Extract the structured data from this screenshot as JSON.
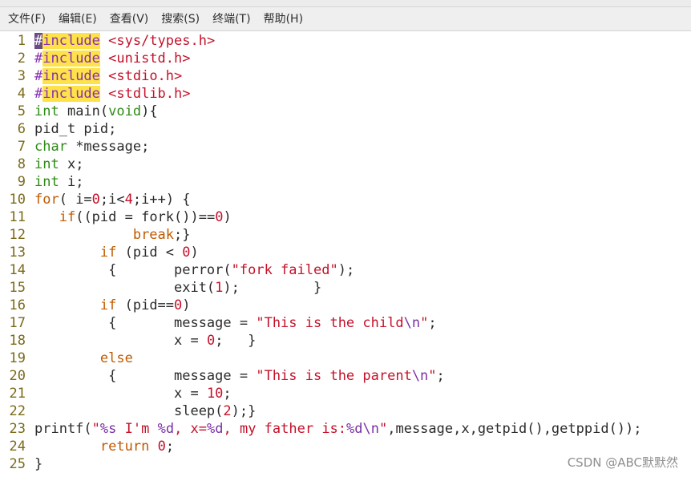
{
  "menubar": {
    "items": [
      "文件(F)",
      "编辑(E)",
      "查看(V)",
      "搜索(S)",
      "终端(T)",
      "帮助(H)"
    ]
  },
  "editor": {
    "lines": [
      {
        "no": "1",
        "tokens": [
          {
            "t": "#",
            "c": "hash"
          },
          {
            "t": "include",
            "c": "kw-incl hl"
          },
          {
            "t": " <sys/types.h>",
            "c": "str"
          }
        ]
      },
      {
        "no": "2",
        "tokens": [
          {
            "t": "#",
            "c": "kw-incl"
          },
          {
            "t": "include",
            "c": "kw-incl hl"
          },
          {
            "t": " <unistd.h>",
            "c": "str"
          }
        ]
      },
      {
        "no": "3",
        "tokens": [
          {
            "t": "#",
            "c": "kw-incl"
          },
          {
            "t": "include",
            "c": "kw-incl hl"
          },
          {
            "t": " <stdio.h>",
            "c": "str"
          }
        ]
      },
      {
        "no": "4",
        "tokens": [
          {
            "t": "#",
            "c": "kw-incl"
          },
          {
            "t": "include",
            "c": "kw-incl hl"
          },
          {
            "t": " <stdlib.h>",
            "c": "str"
          }
        ]
      },
      {
        "no": "5",
        "tokens": [
          {
            "t": "int",
            "c": "ty"
          },
          {
            "t": " main(",
            "c": ""
          },
          {
            "t": "void",
            "c": "ty"
          },
          {
            "t": "){",
            "c": ""
          }
        ]
      },
      {
        "no": "6",
        "tokens": [
          {
            "t": "pid_t pid;",
            "c": ""
          }
        ]
      },
      {
        "no": "7",
        "tokens": [
          {
            "t": "char",
            "c": "ty"
          },
          {
            "t": " *message;",
            "c": ""
          }
        ]
      },
      {
        "no": "8",
        "tokens": [
          {
            "t": "int",
            "c": "ty"
          },
          {
            "t": " x;",
            "c": ""
          }
        ]
      },
      {
        "no": "9",
        "tokens": [
          {
            "t": "int",
            "c": "ty"
          },
          {
            "t": " i;",
            "c": ""
          }
        ]
      },
      {
        "no": "10",
        "tokens": [
          {
            "t": "for",
            "c": "kw"
          },
          {
            "t": "( i=",
            "c": ""
          },
          {
            "t": "0",
            "c": "num"
          },
          {
            "t": ";i<",
            "c": ""
          },
          {
            "t": "4",
            "c": "num"
          },
          {
            "t": ";i++) {",
            "c": ""
          }
        ]
      },
      {
        "no": "11",
        "tokens": [
          {
            "t": "   ",
            "c": ""
          },
          {
            "t": "if",
            "c": "kw"
          },
          {
            "t": "((pid = fork())==",
            "c": ""
          },
          {
            "t": "0",
            "c": "num"
          },
          {
            "t": ")",
            "c": ""
          }
        ]
      },
      {
        "no": "12",
        "tokens": [
          {
            "t": "            ",
            "c": ""
          },
          {
            "t": "break",
            "c": "kw"
          },
          {
            "t": ";}",
            "c": ""
          }
        ]
      },
      {
        "no": "13",
        "tokens": [
          {
            "t": "        ",
            "c": ""
          },
          {
            "t": "if",
            "c": "kw"
          },
          {
            "t": " (pid < ",
            "c": ""
          },
          {
            "t": "0",
            "c": "num"
          },
          {
            "t": ")",
            "c": ""
          }
        ]
      },
      {
        "no": "14",
        "tokens": [
          {
            "t": "         {       perror(",
            "c": ""
          },
          {
            "t": "\"fork failed\"",
            "c": "str"
          },
          {
            "t": ");",
            "c": ""
          }
        ]
      },
      {
        "no": "15",
        "tokens": [
          {
            "t": "                 exit(",
            "c": ""
          },
          {
            "t": "1",
            "c": "num"
          },
          {
            "t": ");         }",
            "c": ""
          }
        ]
      },
      {
        "no": "16",
        "tokens": [
          {
            "t": "        ",
            "c": ""
          },
          {
            "t": "if",
            "c": "kw"
          },
          {
            "t": " (pid==",
            "c": ""
          },
          {
            "t": "0",
            "c": "num"
          },
          {
            "t": ")",
            "c": ""
          }
        ]
      },
      {
        "no": "17",
        "tokens": [
          {
            "t": "         {       message = ",
            "c": ""
          },
          {
            "t": "\"This is the child",
            "c": "str"
          },
          {
            "t": "\\n",
            "c": "esc"
          },
          {
            "t": "\"",
            "c": "str"
          },
          {
            "t": ";",
            "c": ""
          }
        ]
      },
      {
        "no": "18",
        "tokens": [
          {
            "t": "                 x = ",
            "c": ""
          },
          {
            "t": "0",
            "c": "num"
          },
          {
            "t": ";   }",
            "c": ""
          }
        ]
      },
      {
        "no": "19",
        "tokens": [
          {
            "t": "        ",
            "c": ""
          },
          {
            "t": "else",
            "c": "kw"
          }
        ]
      },
      {
        "no": "20",
        "tokens": [
          {
            "t": "         {       message = ",
            "c": ""
          },
          {
            "t": "\"This is the parent",
            "c": "str"
          },
          {
            "t": "\\n",
            "c": "esc"
          },
          {
            "t": "\"",
            "c": "str"
          },
          {
            "t": ";",
            "c": ""
          }
        ]
      },
      {
        "no": "21",
        "tokens": [
          {
            "t": "                 x = ",
            "c": ""
          },
          {
            "t": "10",
            "c": "num"
          },
          {
            "t": ";",
            "c": ""
          }
        ]
      },
      {
        "no": "22",
        "tokens": [
          {
            "t": "                 sleep(",
            "c": ""
          },
          {
            "t": "2",
            "c": "num"
          },
          {
            "t": ");}",
            "c": ""
          }
        ]
      },
      {
        "no": "23",
        "tokens": [
          {
            "t": "printf(",
            "c": ""
          },
          {
            "t": "\"",
            "c": "str"
          },
          {
            "t": "%s",
            "c": "esc"
          },
          {
            "t": " I'm ",
            "c": "str"
          },
          {
            "t": "%d",
            "c": "esc"
          },
          {
            "t": ", x=",
            "c": "str"
          },
          {
            "t": "%d",
            "c": "esc"
          },
          {
            "t": ", my father is:",
            "c": "str"
          },
          {
            "t": "%d\\n",
            "c": "esc"
          },
          {
            "t": "\"",
            "c": "str"
          },
          {
            "t": ",message,x,getpid(),getppid());",
            "c": ""
          }
        ]
      },
      {
        "no": "24",
        "tokens": [
          {
            "t": "        ",
            "c": ""
          },
          {
            "t": "return",
            "c": "kw"
          },
          {
            "t": " ",
            "c": ""
          },
          {
            "t": "0",
            "c": "num"
          },
          {
            "t": ";",
            "c": ""
          }
        ]
      },
      {
        "no": "25",
        "tokens": [
          {
            "t": "}",
            "c": ""
          }
        ]
      }
    ]
  },
  "watermark": "CSDN @ABC默默然"
}
